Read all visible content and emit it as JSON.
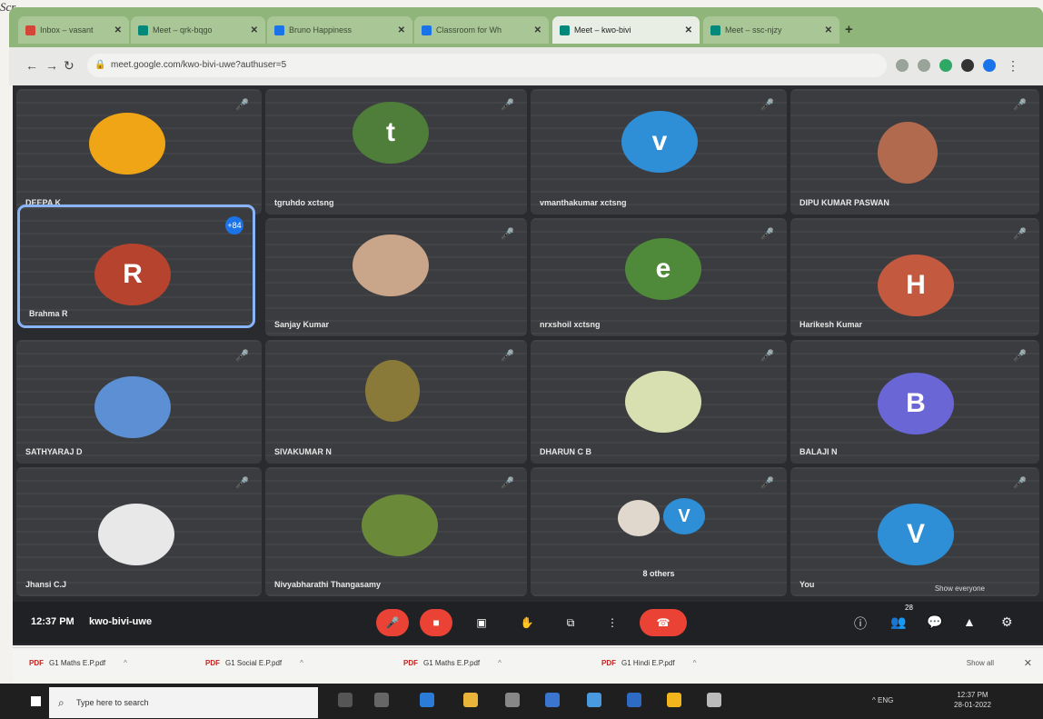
{
  "corner_text": "Scr",
  "browser": {
    "tabs": [
      {
        "title": "Inbox – vasant"
      },
      {
        "title": "Meet – qrk-bqgo"
      },
      {
        "title": "Bruno Happiness"
      },
      {
        "title": "Classroom for Wh"
      },
      {
        "title": "Meet – kwo-bivi",
        "active": true
      },
      {
        "title": "Meet – ssc-njzy"
      }
    ],
    "new_tab_label": "+",
    "address": "meet.google.com/kwo-bivi-uwe?authuser=5"
  },
  "meeting": {
    "participants": [
      {
        "name": "DEEPA K",
        "type": "photo",
        "color": "#f0a516"
      },
      {
        "name": "tgruhdo xctsng",
        "type": "letter",
        "letter": "t",
        "color": "#4f7d3a"
      },
      {
        "name": "vmanthakumar xctsng",
        "type": "letter",
        "letter": "v",
        "color": "#2e8ed6"
      },
      {
        "name": "DIPU KUMAR PASWAN",
        "type": "photo",
        "color": "#b26a4e"
      },
      {
        "name": "Brahma R",
        "type": "letter",
        "letter": "R",
        "color": "#b5432e",
        "active": true
      },
      {
        "name": "Sanjay Kumar",
        "type": "photo",
        "color": "#c9a58a"
      },
      {
        "name": "nrxshoil xctsng",
        "type": "letter",
        "letter": "e",
        "color": "#4f8a3a"
      },
      {
        "name": "Harikesh Kumar",
        "type": "letter",
        "letter": "H",
        "color": "#c35a3f"
      },
      {
        "name": "SATHYARAJ D",
        "type": "photo",
        "color": "#5c8fd4"
      },
      {
        "name": "SIVAKUMAR N",
        "type": "photo",
        "color": "#8a7a3a"
      },
      {
        "name": "DHARUN C B",
        "type": "photo",
        "color": "#d8dfb0"
      },
      {
        "name": "BALAJI N",
        "type": "letter",
        "letter": "B",
        "color": "#6a66d6"
      },
      {
        "name": "Jhansi C.J",
        "type": "photo",
        "color": "#e8e8e8"
      },
      {
        "name": "Nivyabharathi Thangasamy",
        "type": "photo",
        "color": "#6a8a3a"
      },
      {
        "name": "8 others",
        "type": "others",
        "letter": "V",
        "color": "#2e8ed6"
      },
      {
        "name": "You",
        "type": "letter",
        "letter": "V",
        "color": "#2e8ed6",
        "show_everyone": "Show everyone"
      }
    ],
    "active_badge": "+84",
    "time": "12:37 PM",
    "code": "kwo-bivi-uwe",
    "people_count": "28",
    "colors": {
      "accent": "#8ab4f8",
      "danger": "#ea4335",
      "bg": "#202124"
    }
  },
  "downloads": {
    "items": [
      {
        "name": "G1 Maths E.P.pdf"
      },
      {
        "name": "G1 Social E.P.pdf"
      },
      {
        "name": "G1 Maths E.P.pdf"
      },
      {
        "name": "G1 Hindi E.P.pdf"
      }
    ],
    "pdf_label": "PDF",
    "show_all": "Show all"
  },
  "taskbar": {
    "search_placeholder": "Type here to search",
    "time": "12:37 PM",
    "date": "28-01-2022",
    "tray": "^ ENG"
  }
}
